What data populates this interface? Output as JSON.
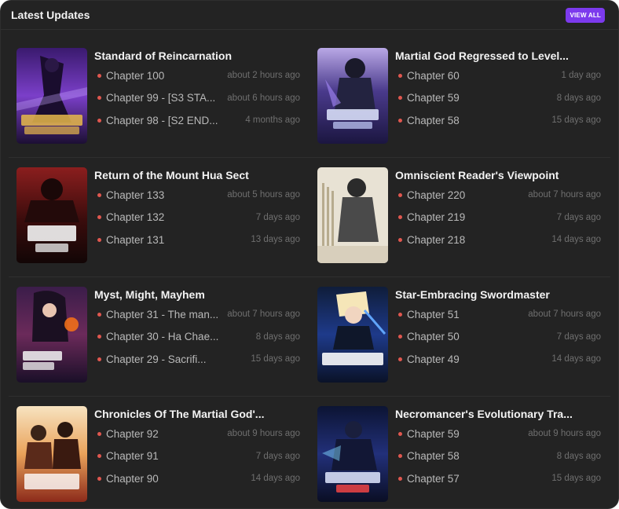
{
  "header": {
    "title": "Latest Updates",
    "view_all": "VIEW ALL"
  },
  "colors": {
    "panel_bg": "#232323",
    "accent": "#7c3aed",
    "bullet": "#e0574f"
  },
  "cards": [
    {
      "title": "Standard of Reincarnation",
      "chapters": [
        {
          "label": "Chapter 100",
          "time": "about 2 hours ago"
        },
        {
          "label": "Chapter 99 - [S3 STA...",
          "time": "about 6 hours ago"
        },
        {
          "label": "Chapter 98 - [S2 END...",
          "time": "4 months ago"
        }
      ]
    },
    {
      "title": "Martial God Regressed to Level...",
      "chapters": [
        {
          "label": "Chapter 60",
          "time": "1 day ago"
        },
        {
          "label": "Chapter 59",
          "time": "8 days ago"
        },
        {
          "label": "Chapter 58",
          "time": "15 days ago"
        }
      ]
    },
    {
      "title": "Return of the Mount Hua Sect",
      "chapters": [
        {
          "label": "Chapter 133",
          "time": "about 5 hours ago"
        },
        {
          "label": "Chapter 132",
          "time": "7 days ago"
        },
        {
          "label": "Chapter 131",
          "time": "13 days ago"
        }
      ]
    },
    {
      "title": "Omniscient Reader's Viewpoint",
      "chapters": [
        {
          "label": "Chapter 220",
          "time": "about 7 hours ago"
        },
        {
          "label": "Chapter 219",
          "time": "7 days ago"
        },
        {
          "label": "Chapter 218",
          "time": "14 days ago"
        }
      ]
    },
    {
      "title": "Myst, Might, Mayhem",
      "chapters": [
        {
          "label": "Chapter 31 - The man...",
          "time": "about 7 hours ago"
        },
        {
          "label": "Chapter 30 - Ha Chae...",
          "time": "8 days ago"
        },
        {
          "label": "Chapter 29 - Sacrifi...",
          "time": "15 days ago"
        }
      ]
    },
    {
      "title": "Star-Embracing Swordmaster",
      "chapters": [
        {
          "label": "Chapter 51",
          "time": "about 7 hours ago"
        },
        {
          "label": "Chapter 50",
          "time": "7 days ago"
        },
        {
          "label": "Chapter 49",
          "time": "14 days ago"
        }
      ]
    },
    {
      "title": "Chronicles Of The Martial God'...",
      "chapters": [
        {
          "label": "Chapter 92",
          "time": "about 9 hours ago"
        },
        {
          "label": "Chapter 91",
          "time": "7 days ago"
        },
        {
          "label": "Chapter 90",
          "time": "14 days ago"
        }
      ]
    },
    {
      "title": "Necromancer's Evolutionary Tra...",
      "chapters": [
        {
          "label": "Chapter 59",
          "time": "about 9 hours ago"
        },
        {
          "label": "Chapter 58",
          "time": "8 days ago"
        },
        {
          "label": "Chapter 57",
          "time": "15 days ago"
        }
      ]
    }
  ]
}
